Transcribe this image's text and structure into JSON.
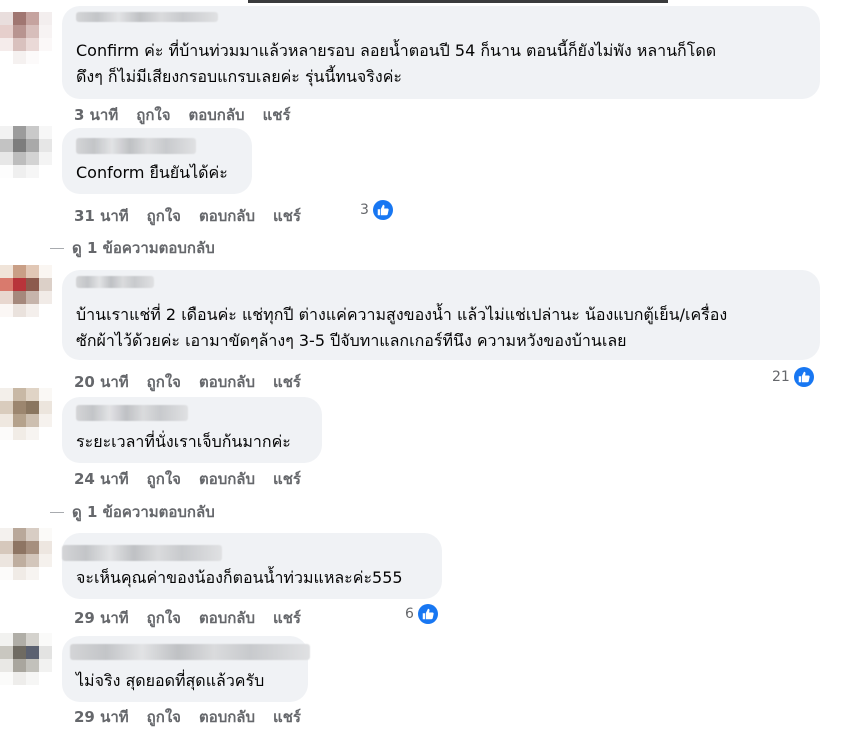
{
  "comments": [
    {
      "text_lines": [
        "Confirm ค่ะ ที่บ้านท่วมมาแล้วหลายรอบ ลอยน้ำตอนปี 54 ก็นาน ตอนนี้ก็ยังไม่พัง หลานก็โดด",
        "ดึงๆ ก็ไม่มีเสียงกรอบแกรบเลยค่ะ รุ่นนี้ทนจริงค่ะ"
      ],
      "time": "3 นาที",
      "like": "ถูกใจ",
      "reply": "ตอบกลับ",
      "share": "แชร์"
    },
    {
      "text_lines": [
        "Conform ยืนยันได้ค่ะ"
      ],
      "time": "31 นาที",
      "like": "ถูกใจ",
      "reply": "ตอบกลับ",
      "share": "แชร์",
      "reaction_count": "3",
      "view_replies": "ดู 1 ข้อความตอบกลับ"
    },
    {
      "text_lines": [
        "บ้านเราแช่ที่ 2 เดือนค่ะ แช่ทุกปี ต่างแค่ความสูงของน้ำ แล้วไม่แช่เปล่านะ น้องแบกตู้เย็น/เครื่อง",
        "ซักผ้าไว้ด้วยค่ะ เอามาขัดๆล้างๆ 3-5 ปีจับทาแลกเกอร์ทีนึง ความหวังของบ้านเลย"
      ],
      "time": "20 นาที",
      "like": "ถูกใจ",
      "reply": "ตอบกลับ",
      "share": "แชร์",
      "reaction_count": "21"
    },
    {
      "text_lines": [
        "ระยะเวลาที่นั่งเราเจ็บก้นมากค่ะ"
      ],
      "time": "24 นาที",
      "like": "ถูกใจ",
      "reply": "ตอบกลับ",
      "share": "แชร์",
      "view_replies": "ดู 1 ข้อความตอบกลับ"
    },
    {
      "text_lines": [
        "จะเห็นคุณค่าของน้องก็ตอนน้ำท่วมแหละค่ะ555"
      ],
      "time": "29 นาที",
      "like": "ถูกใจ",
      "reply": "ตอบกลับ",
      "share": "แชร์",
      "reaction_count": "6"
    },
    {
      "text_lines": [
        "ไม่จริง สุดยอดที่สุดแล้วครับ"
      ],
      "time": "29 นาที",
      "like": "ถูกใจ",
      "reply": "ตอบกลับ",
      "share": "แชร์"
    }
  ],
  "colors": {
    "bubble": "#f0f2f5",
    "meta_text": "#65676b",
    "like_blue": "#1877f2"
  },
  "icons": {
    "reaction": "like-thumbs-up-icon",
    "avatar": "user-avatar-pixelated"
  }
}
